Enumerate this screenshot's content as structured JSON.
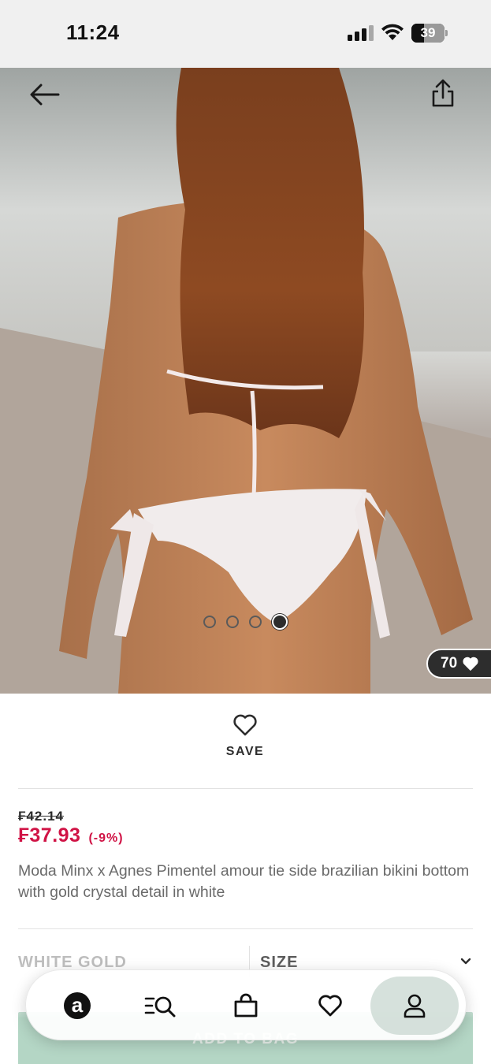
{
  "status_bar": {
    "time": "11:24",
    "battery": "39",
    "battery_level": 0.39
  },
  "hero": {
    "icons": {
      "back": "arrow-left-icon",
      "share": "share-icon",
      "likes": "heart-filled-icon"
    },
    "carousel_total": 4,
    "carousel_active": 4,
    "likes_count": "70"
  },
  "product": {
    "save_label": "SAVE",
    "was_price": "₣42.14",
    "now_price": "₣37.93",
    "discount": "(-9%)",
    "title": "Moda Minx x Agnes Pimentel amour tie side brazilian bikini bottom with gold crystal detail in white",
    "colour": "WHITE GOLD",
    "size_label": "SIZE",
    "add_to_bag": "ADD TO BAG"
  },
  "colors": {
    "price_red": "#d01345",
    "text_dark": "#2d2d2d",
    "add_to_bag_green": "#b4d6c5",
    "nav_active": "#c8d7d0"
  },
  "bottom_nav": {
    "items": [
      {
        "name": "home",
        "icon": "asos-logo-icon",
        "letter": "a"
      },
      {
        "name": "search",
        "icon": "search-menu-icon"
      },
      {
        "name": "bag",
        "icon": "bag-icon"
      },
      {
        "name": "saved",
        "icon": "heart-icon"
      },
      {
        "name": "account",
        "icon": "person-icon",
        "active": true
      }
    ]
  }
}
